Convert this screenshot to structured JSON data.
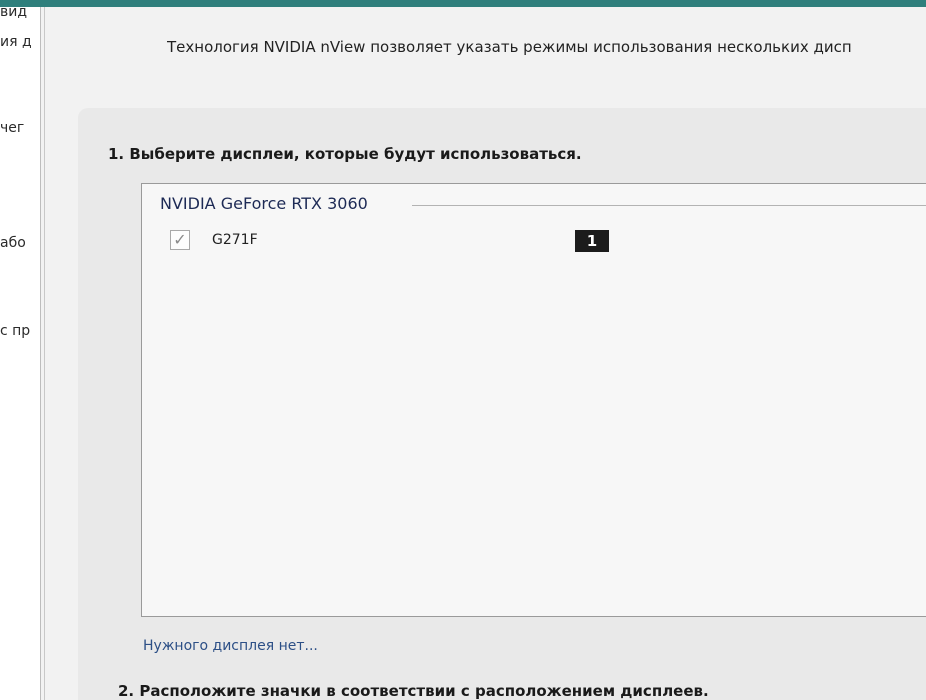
{
  "sidebar": {
    "fragments": [
      "вид",
      "ия д",
      "чег",
      "або",
      "с пр"
    ]
  },
  "header": {
    "intro_text": "Технология NVIDIA nView позволяет указать режимы использования нескольких дисп"
  },
  "step1": {
    "title": "1. Выберите дисплеи, которые будут использоваться."
  },
  "gpu": {
    "name": "NVIDIA GeForce RTX 3060",
    "displays": [
      {
        "name": "G271F",
        "checked": true,
        "number": "1"
      }
    ]
  },
  "missing_display_link": "Нужного дисплея нет...",
  "step2": {
    "title": "2. Расположите значки в соответствии с расположением дисплеев."
  },
  "colors": {
    "top_bar": "#2f7f7c",
    "link": "#2c4f86",
    "gpu_label": "#1d2a55",
    "number_badge": "#1c1c1c"
  },
  "icons": {
    "checkbox": "check-icon"
  }
}
